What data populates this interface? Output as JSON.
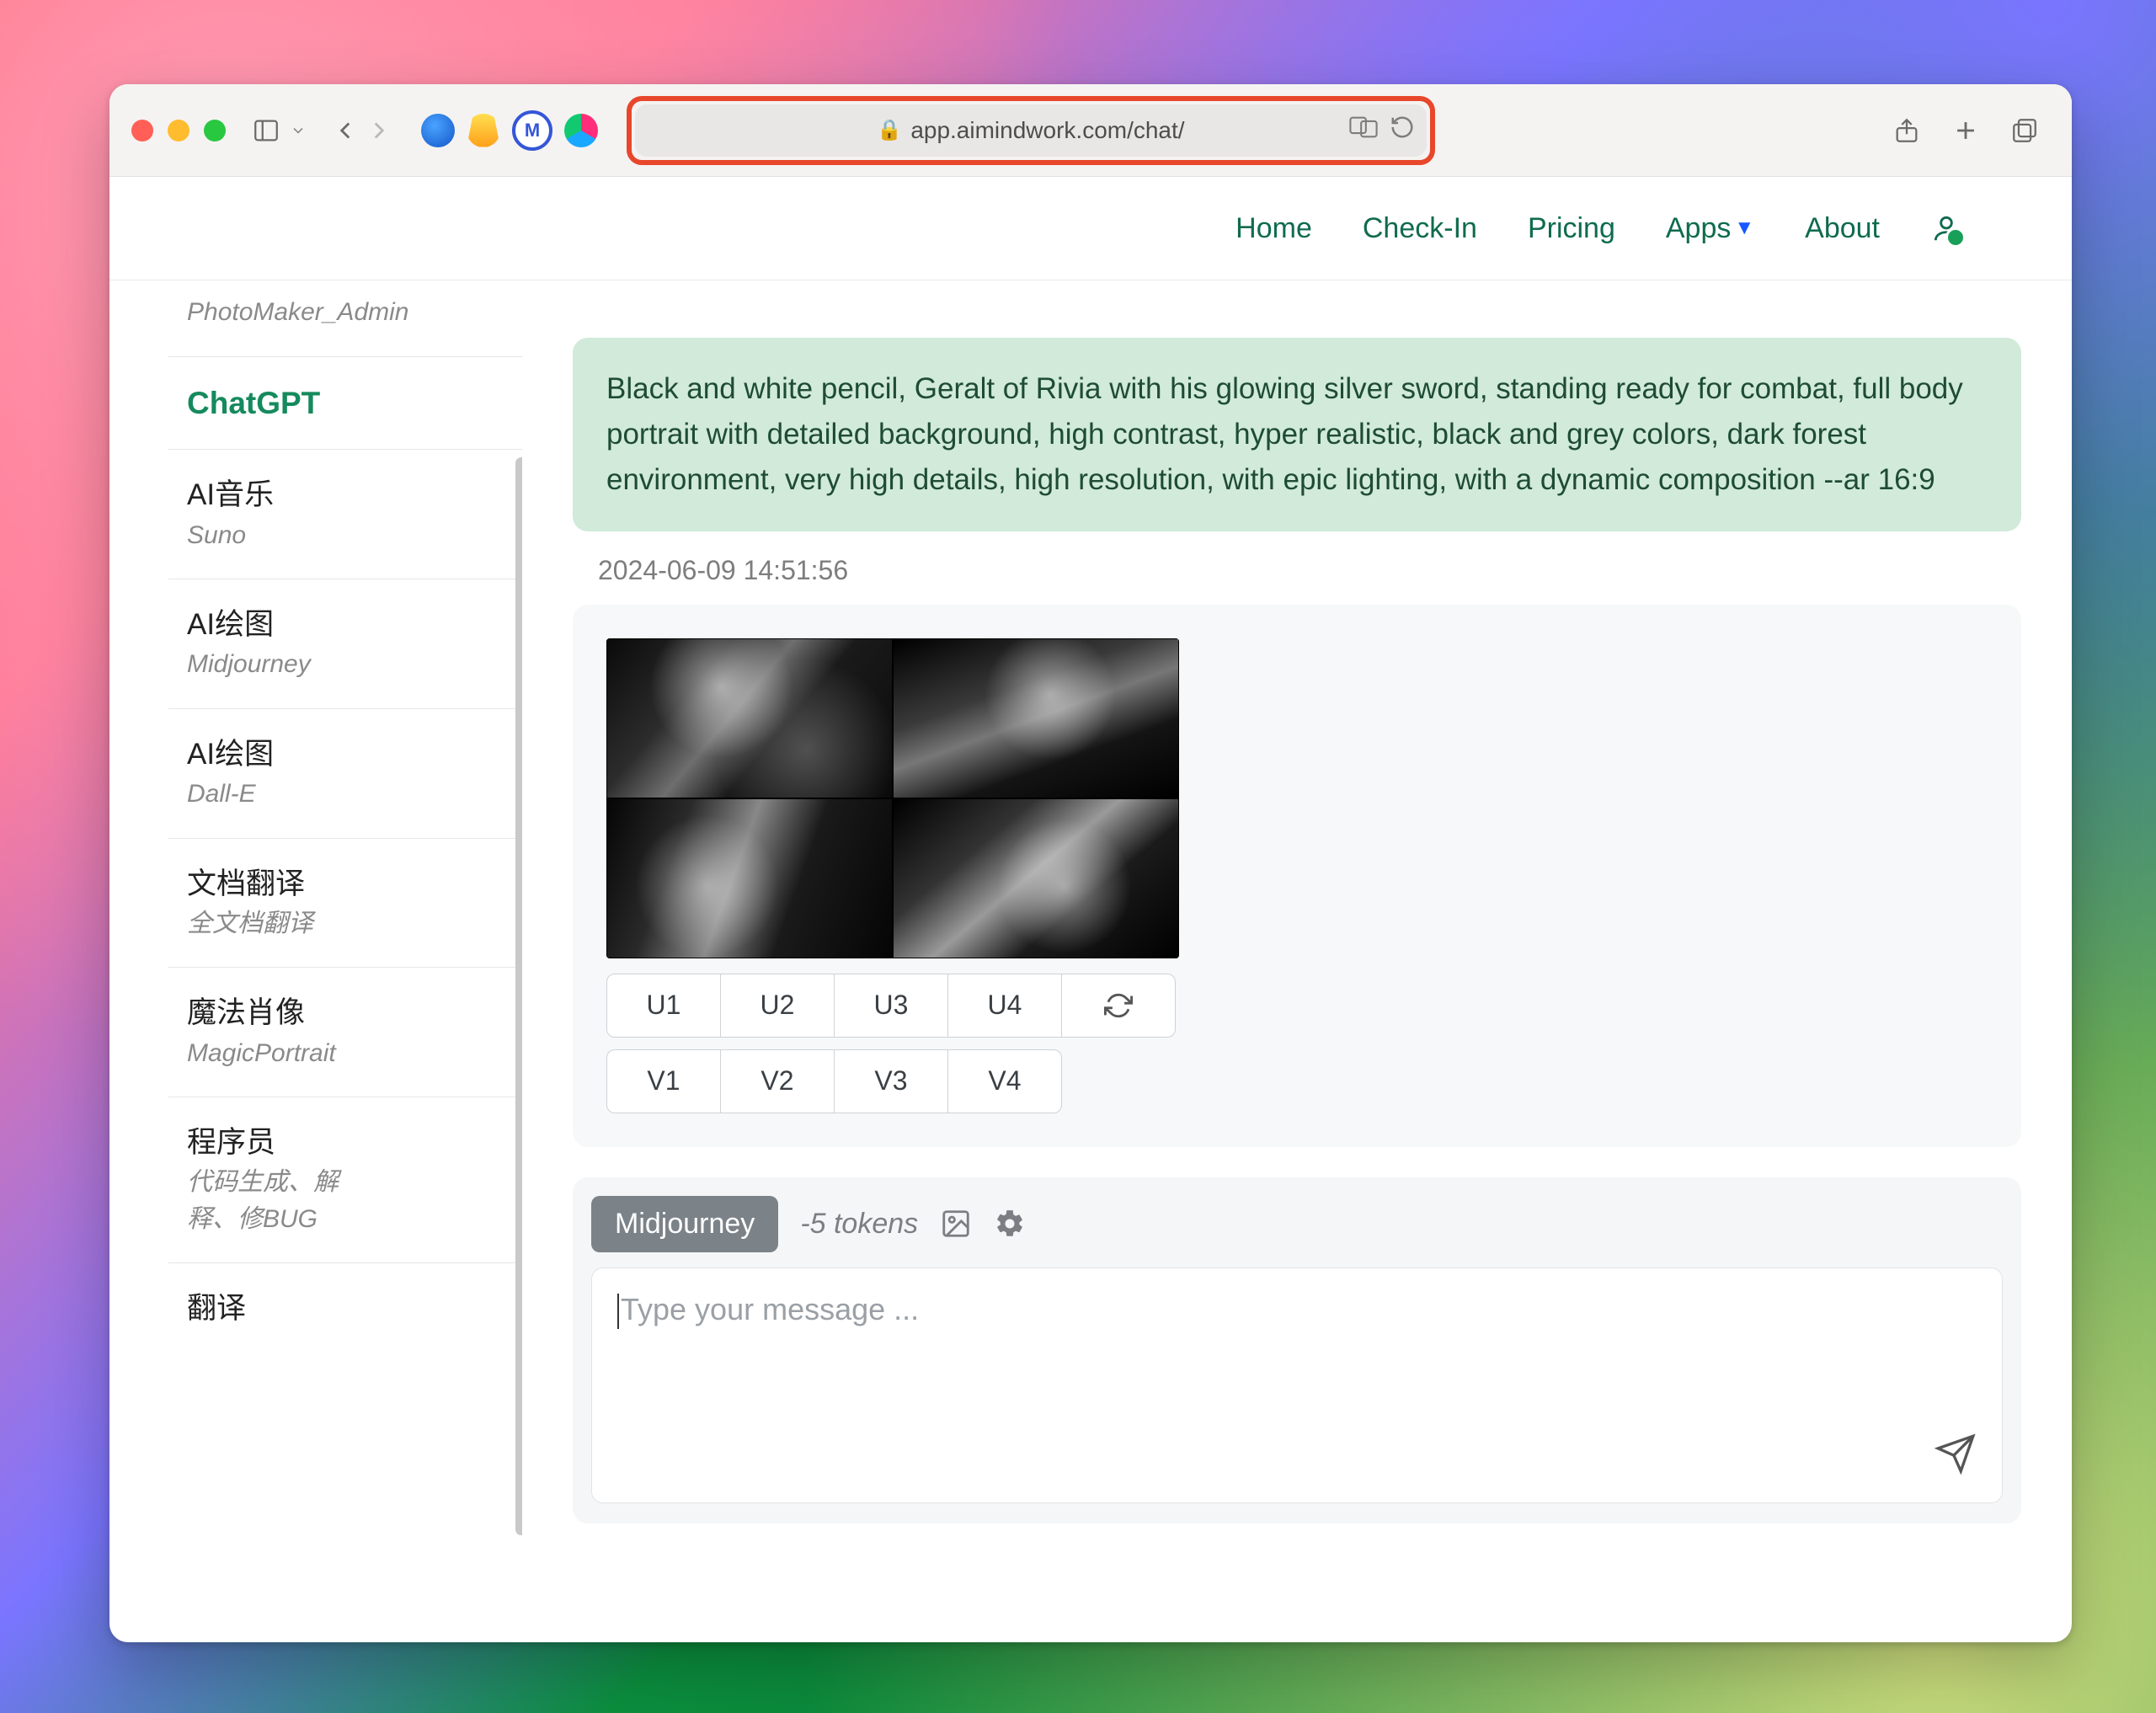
{
  "browser": {
    "url": "app.aimindwork.com/chat/"
  },
  "nav": {
    "home": "Home",
    "checkin": "Check-In",
    "pricing": "Pricing",
    "apps": "Apps",
    "about": "About"
  },
  "sidebar": {
    "items": [
      {
        "title": "",
        "sub": "PhotoMaker_Admin"
      },
      {
        "title": "ChatGPT",
        "sub": ""
      },
      {
        "title": "AI音乐",
        "sub": "Suno"
      },
      {
        "title": "AI绘图",
        "sub": "Midjourney"
      },
      {
        "title": "AI绘图",
        "sub": "Dall-E"
      },
      {
        "title": "文档翻译",
        "sub": "全文档翻译"
      },
      {
        "title": "魔法肖像",
        "sub": "MagicPortrait"
      },
      {
        "title": "程序员",
        "sub": "代码生成、解释、修BUG"
      },
      {
        "title": "翻译",
        "sub": ""
      }
    ]
  },
  "chat": {
    "prompt": "Black and white pencil, Geralt of Rivia with his glowing silver sword, standing ready for combat, full body portrait with detailed background, high contrast, hyper realistic, black and grey colors, dark forest environment, very high details, high resolution, with epic lighting, with a dynamic composition --ar 16:9",
    "timestamp": "2024-06-09 14:51:56",
    "buttons_u": [
      "U1",
      "U2",
      "U3",
      "U4"
    ],
    "buttons_v": [
      "V1",
      "V2",
      "V3",
      "V4"
    ]
  },
  "composer": {
    "model": "Midjourney",
    "tokens": "-5 tokens",
    "placeholder": "Type your message ..."
  }
}
